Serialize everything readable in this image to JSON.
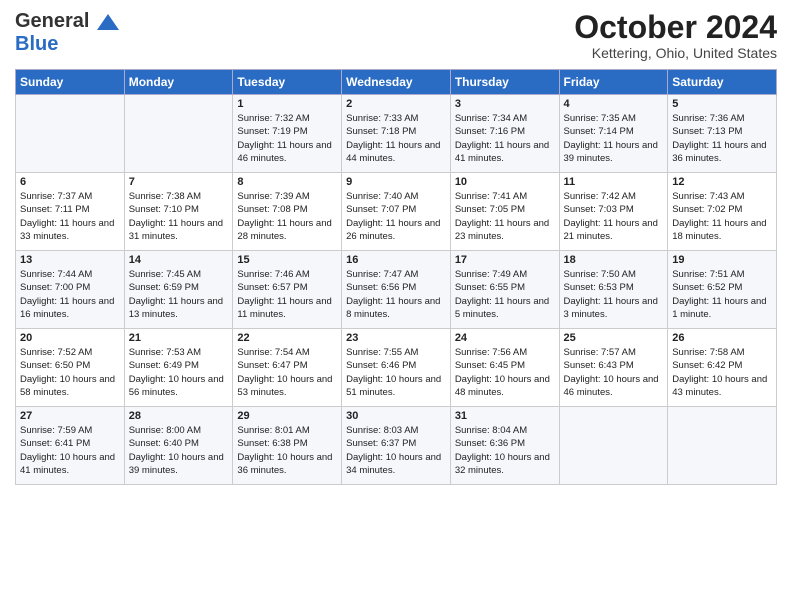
{
  "header": {
    "logo_line1": "General",
    "logo_line2": "Blue",
    "month": "October 2024",
    "location": "Kettering, Ohio, United States"
  },
  "days_of_week": [
    "Sunday",
    "Monday",
    "Tuesday",
    "Wednesday",
    "Thursday",
    "Friday",
    "Saturday"
  ],
  "weeks": [
    [
      {
        "day": "",
        "info": ""
      },
      {
        "day": "",
        "info": ""
      },
      {
        "day": "1",
        "info": "Sunrise: 7:32 AM\nSunset: 7:19 PM\nDaylight: 11 hours and 46 minutes."
      },
      {
        "day": "2",
        "info": "Sunrise: 7:33 AM\nSunset: 7:18 PM\nDaylight: 11 hours and 44 minutes."
      },
      {
        "day": "3",
        "info": "Sunrise: 7:34 AM\nSunset: 7:16 PM\nDaylight: 11 hours and 41 minutes."
      },
      {
        "day": "4",
        "info": "Sunrise: 7:35 AM\nSunset: 7:14 PM\nDaylight: 11 hours and 39 minutes."
      },
      {
        "day": "5",
        "info": "Sunrise: 7:36 AM\nSunset: 7:13 PM\nDaylight: 11 hours and 36 minutes."
      }
    ],
    [
      {
        "day": "6",
        "info": "Sunrise: 7:37 AM\nSunset: 7:11 PM\nDaylight: 11 hours and 33 minutes."
      },
      {
        "day": "7",
        "info": "Sunrise: 7:38 AM\nSunset: 7:10 PM\nDaylight: 11 hours and 31 minutes."
      },
      {
        "day": "8",
        "info": "Sunrise: 7:39 AM\nSunset: 7:08 PM\nDaylight: 11 hours and 28 minutes."
      },
      {
        "day": "9",
        "info": "Sunrise: 7:40 AM\nSunset: 7:07 PM\nDaylight: 11 hours and 26 minutes."
      },
      {
        "day": "10",
        "info": "Sunrise: 7:41 AM\nSunset: 7:05 PM\nDaylight: 11 hours and 23 minutes."
      },
      {
        "day": "11",
        "info": "Sunrise: 7:42 AM\nSunset: 7:03 PM\nDaylight: 11 hours and 21 minutes."
      },
      {
        "day": "12",
        "info": "Sunrise: 7:43 AM\nSunset: 7:02 PM\nDaylight: 11 hours and 18 minutes."
      }
    ],
    [
      {
        "day": "13",
        "info": "Sunrise: 7:44 AM\nSunset: 7:00 PM\nDaylight: 11 hours and 16 minutes."
      },
      {
        "day": "14",
        "info": "Sunrise: 7:45 AM\nSunset: 6:59 PM\nDaylight: 11 hours and 13 minutes."
      },
      {
        "day": "15",
        "info": "Sunrise: 7:46 AM\nSunset: 6:57 PM\nDaylight: 11 hours and 11 minutes."
      },
      {
        "day": "16",
        "info": "Sunrise: 7:47 AM\nSunset: 6:56 PM\nDaylight: 11 hours and 8 minutes."
      },
      {
        "day": "17",
        "info": "Sunrise: 7:49 AM\nSunset: 6:55 PM\nDaylight: 11 hours and 5 minutes."
      },
      {
        "day": "18",
        "info": "Sunrise: 7:50 AM\nSunset: 6:53 PM\nDaylight: 11 hours and 3 minutes."
      },
      {
        "day": "19",
        "info": "Sunrise: 7:51 AM\nSunset: 6:52 PM\nDaylight: 11 hours and 1 minute."
      }
    ],
    [
      {
        "day": "20",
        "info": "Sunrise: 7:52 AM\nSunset: 6:50 PM\nDaylight: 10 hours and 58 minutes."
      },
      {
        "day": "21",
        "info": "Sunrise: 7:53 AM\nSunset: 6:49 PM\nDaylight: 10 hours and 56 minutes."
      },
      {
        "day": "22",
        "info": "Sunrise: 7:54 AM\nSunset: 6:47 PM\nDaylight: 10 hours and 53 minutes."
      },
      {
        "day": "23",
        "info": "Sunrise: 7:55 AM\nSunset: 6:46 PM\nDaylight: 10 hours and 51 minutes."
      },
      {
        "day": "24",
        "info": "Sunrise: 7:56 AM\nSunset: 6:45 PM\nDaylight: 10 hours and 48 minutes."
      },
      {
        "day": "25",
        "info": "Sunrise: 7:57 AM\nSunset: 6:43 PM\nDaylight: 10 hours and 46 minutes."
      },
      {
        "day": "26",
        "info": "Sunrise: 7:58 AM\nSunset: 6:42 PM\nDaylight: 10 hours and 43 minutes."
      }
    ],
    [
      {
        "day": "27",
        "info": "Sunrise: 7:59 AM\nSunset: 6:41 PM\nDaylight: 10 hours and 41 minutes."
      },
      {
        "day": "28",
        "info": "Sunrise: 8:00 AM\nSunset: 6:40 PM\nDaylight: 10 hours and 39 minutes."
      },
      {
        "day": "29",
        "info": "Sunrise: 8:01 AM\nSunset: 6:38 PM\nDaylight: 10 hours and 36 minutes."
      },
      {
        "day": "30",
        "info": "Sunrise: 8:03 AM\nSunset: 6:37 PM\nDaylight: 10 hours and 34 minutes."
      },
      {
        "day": "31",
        "info": "Sunrise: 8:04 AM\nSunset: 6:36 PM\nDaylight: 10 hours and 32 minutes."
      },
      {
        "day": "",
        "info": ""
      },
      {
        "day": "",
        "info": ""
      }
    ]
  ]
}
